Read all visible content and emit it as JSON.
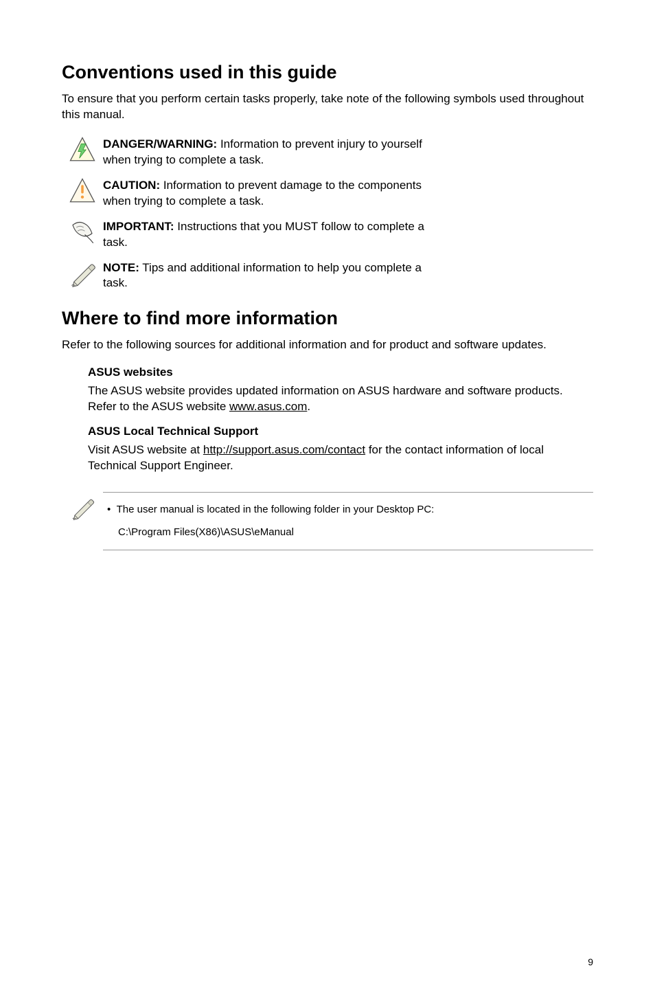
{
  "section1": {
    "title": "Conventions used in this guide",
    "intro": "To ensure that you perform certain tasks properly, take note of the following symbols used throughout this manual.",
    "items": [
      {
        "label": "DANGER/WARNING:",
        "text": " Information to prevent injury to yourself when trying to complete a task."
      },
      {
        "label": "CAUTION:",
        "text": " Information to prevent damage to the components when trying to complete a task."
      },
      {
        "label": "IMPORTANT:",
        "text": " Instructions that you MUST follow to complete a task."
      },
      {
        "label": "NOTE:",
        "text": " Tips and additional information to help you complete a task."
      }
    ]
  },
  "section2": {
    "title": "Where to find more information",
    "intro": "Refer to the following sources for additional information and for product and software updates.",
    "asus_sites_heading": "ASUS websites",
    "asus_sites_text_before": "The ASUS website provides updated information on ASUS hardware and software products. Refer to the ASUS website ",
    "asus_sites_link": "www.asus.com",
    "asus_sites_text_after": ".",
    "support_heading": "ASUS Local Technical Support",
    "support_text_before": "Visit ASUS website at ",
    "support_link": "http://support.asus.com/contact",
    "support_text_after": " for the contact information of local Technical Support Engineer."
  },
  "note_box": {
    "bullet": "The user manual is located in the following folder in your Desktop PC:",
    "path": "C:\\Program Files(X86)\\ASUS\\eManual"
  },
  "page_number": "9"
}
